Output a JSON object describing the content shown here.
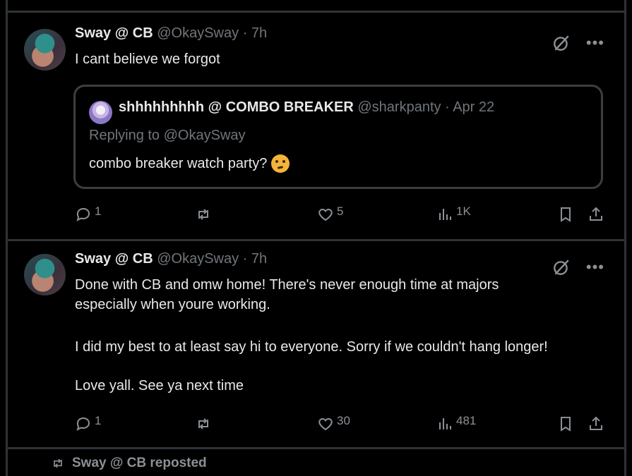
{
  "posts": [
    {
      "author_name": "Sway @ CB",
      "handle": "@OkaySway",
      "time": "· 7h",
      "text_lines": [
        "I cant believe we forgot"
      ],
      "quote": {
        "author_name": "shhhhhhhhh @ COMBO BREAKER",
        "handle": "@sharkpanty",
        "time": "· Apr 22",
        "replying_to": "Replying to @OkaySway",
        "text": "combo breaker watch party?",
        "emoji": "thinking-face-emoji"
      },
      "stats": {
        "replies": "1",
        "reposts": "",
        "likes": "5",
        "views": "1K"
      }
    },
    {
      "author_name": "Sway @ CB",
      "handle": "@OkaySway",
      "time": "· 7h",
      "text_lines": [
        "Done with CB and omw home! There's never enough time at majors",
        "especially when youre working.",
        "I did my best to at least say hi to everyone. Sorry if we couldn't hang longer!",
        "Love yall. See ya next time"
      ],
      "stats": {
        "replies": "1",
        "reposts": "",
        "likes": "30",
        "views": "481"
      }
    }
  ],
  "repost_notice": {
    "text": "Sway @ CB reposted"
  },
  "icons": {
    "reply": "reply-icon",
    "repost": "repost-icon",
    "like": "like-icon",
    "views": "views-icon",
    "bookmark": "bookmark-icon",
    "share": "share-icon",
    "grok": "grok-icon",
    "more": "more-icon"
  },
  "colors": {
    "background": "#000000",
    "text": "#e7e9ea",
    "muted": "#71767b",
    "border": "#2f3336"
  }
}
